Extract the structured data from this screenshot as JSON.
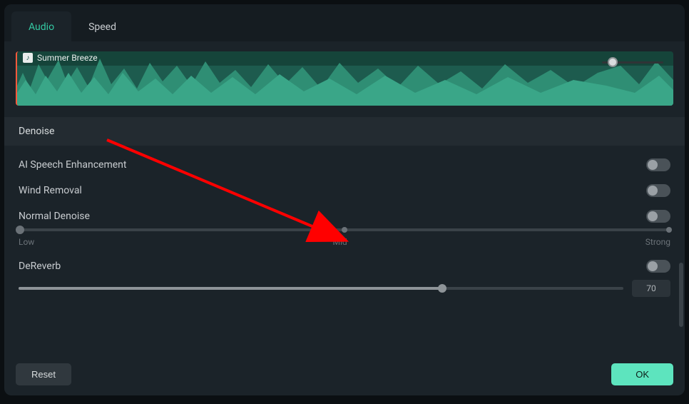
{
  "tabs": {
    "audio": "Audio",
    "speed": "Speed"
  },
  "clip": {
    "title": "Summer Breeze"
  },
  "section": {
    "denoise": "Denoise"
  },
  "options": {
    "ai_speech": {
      "label": "AI Speech Enhancement",
      "on": false
    },
    "wind_removal": {
      "label": "Wind Removal",
      "on": false
    },
    "normal_denoise": {
      "label": "Normal Denoise",
      "on": false,
      "slider": {
        "low": "Low",
        "mid": "Mid",
        "strong": "Strong",
        "value": "low"
      }
    },
    "dereverb": {
      "label": "DeReverb",
      "on": false,
      "value": "70"
    }
  },
  "footer": {
    "reset": "Reset",
    "ok": "OK"
  },
  "colors": {
    "accent": "#5de4be",
    "accent_text": "#34c9a3"
  },
  "annotation": {
    "type": "arrow",
    "color": "#ff0000"
  }
}
